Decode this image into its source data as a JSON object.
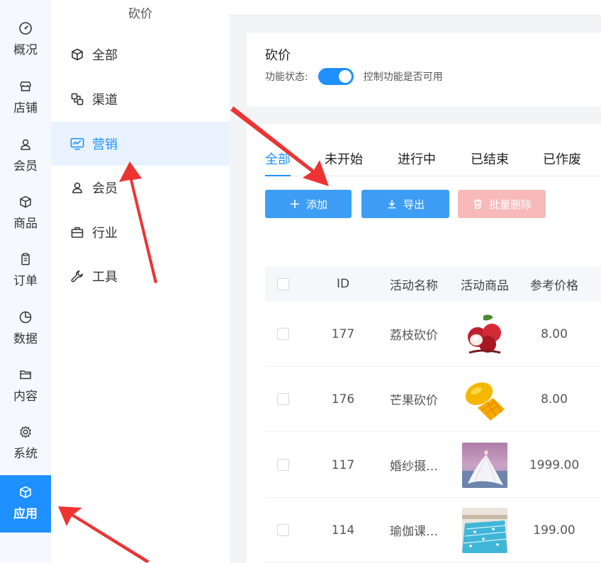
{
  "rail": {
    "items": [
      {
        "label": "概况",
        "icon": "dashboard-icon"
      },
      {
        "label": "店铺",
        "icon": "store-icon"
      },
      {
        "label": "会员",
        "icon": "user-icon"
      },
      {
        "label": "商品",
        "icon": "box-icon"
      },
      {
        "label": "订单",
        "icon": "clipboard-icon"
      },
      {
        "label": "数据",
        "icon": "pie-chart-icon"
      },
      {
        "label": "内容",
        "icon": "folder-icon"
      },
      {
        "label": "系统",
        "icon": "gear-icon"
      },
      {
        "label": "应用",
        "icon": "cube-icon",
        "active": true
      }
    ]
  },
  "submenu": {
    "title": "砍价",
    "items": [
      {
        "label": "全部",
        "icon": "cube-icon"
      },
      {
        "label": "渠道",
        "icon": "channel-icon"
      },
      {
        "label": "营销",
        "icon": "monitor-chart-icon",
        "active": true
      },
      {
        "label": "会员",
        "icon": "user-icon"
      },
      {
        "label": "行业",
        "icon": "briefcase-icon"
      },
      {
        "label": "工具",
        "icon": "wrench-icon"
      }
    ]
  },
  "header": {
    "title": "砍价",
    "status_label": "功能状态:",
    "switch_on": true,
    "switch_hint": "控制功能是否可用"
  },
  "tabs": [
    "全部",
    "未开始",
    "进行中",
    "已结束",
    "已作废"
  ],
  "active_tab": 0,
  "buttons": {
    "add": "添加",
    "export": "导出",
    "batch_delete": "批量删除"
  },
  "table": {
    "columns": [
      "ID",
      "活动名称",
      "活动商品",
      "参考价格"
    ],
    "rows": [
      {
        "id": "177",
        "name": "荔枝砍价",
        "image": "lychee",
        "price": "8.00"
      },
      {
        "id": "176",
        "name": "芒果砍价",
        "image": "mango",
        "price": "8.00"
      },
      {
        "id": "117",
        "name": "婚纱摄…",
        "image": "wedding-dress",
        "price": "1999.00"
      },
      {
        "id": "114",
        "name": "瑜伽课…",
        "image": "swimming-pool",
        "price": "199.00"
      }
    ]
  },
  "colors": {
    "primary": "#1e90ff",
    "button": "#3d9df5",
    "danger_disabled": "#f7b9b9",
    "annotation": "#ee3333"
  }
}
